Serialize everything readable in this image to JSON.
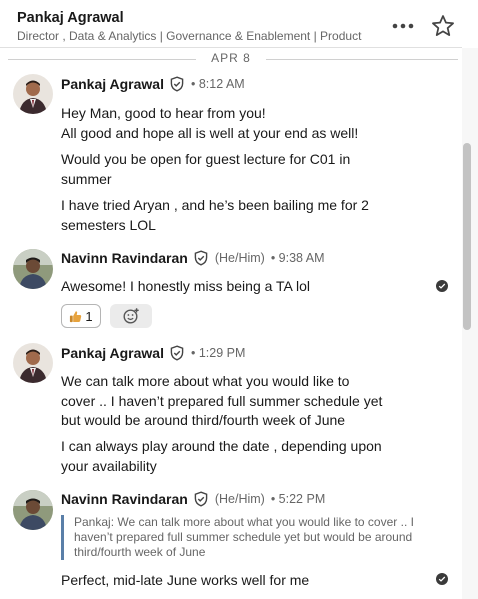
{
  "header": {
    "name": "Pankaj Agrawal",
    "subtitle": "Director , Data & Analytics | Governance & Enablement | Product"
  },
  "date_divider": "APR 8",
  "messages": [
    {
      "sender": "Pankaj Agrawal",
      "time": "• 8:12 AM",
      "paragraphs": [
        "Hey Man, good to hear from you!",
        "All good and hope all is well at your end as well!",
        "Would you be open for guest lecture for C01 in",
        "summer",
        "I have tried Aryan , and he’s been bailing me for 2",
        "semesters LOL"
      ]
    },
    {
      "sender": "Navinn Ravindaran",
      "pronouns": "(He/Him)",
      "time": "• 9:38 AM",
      "paragraphs": [
        "Awesome! I honestly miss being a TA lol"
      ],
      "reaction_count": "1"
    },
    {
      "sender": "Pankaj Agrawal",
      "time": "• 1:29 PM",
      "paragraphs": [
        "We can talk more about what you would like to",
        "cover .. I haven’t prepared full summer schedule yet",
        "but would be around third/fourth week of June",
        "I can always play around the date , depending upon",
        "your availability"
      ]
    },
    {
      "sender": "Navinn Ravindaran",
      "pronouns": "(He/Him)",
      "time": "• 5:22 PM",
      "quote": [
        "Pankaj: We can talk more about what you would like to cover .. I",
        "haven’t prepared full summer schedule yet but would be around",
        "third/fourth week of June"
      ],
      "paragraphs": [
        "Perfect, mid-late June works well for me"
      ]
    }
  ],
  "icons": {
    "more": "more-horizontal-icon",
    "star": "star-icon",
    "verified": "verified-shield-icon",
    "read": "read-receipt-icon",
    "thumbs_up": "thumbs-up-icon",
    "add_reaction": "add-reaction-icon"
  },
  "colors": {
    "thumbs_up": "#e7a33e",
    "quote_bar": "#5a7fa8",
    "secondary_text": "#666666"
  }
}
